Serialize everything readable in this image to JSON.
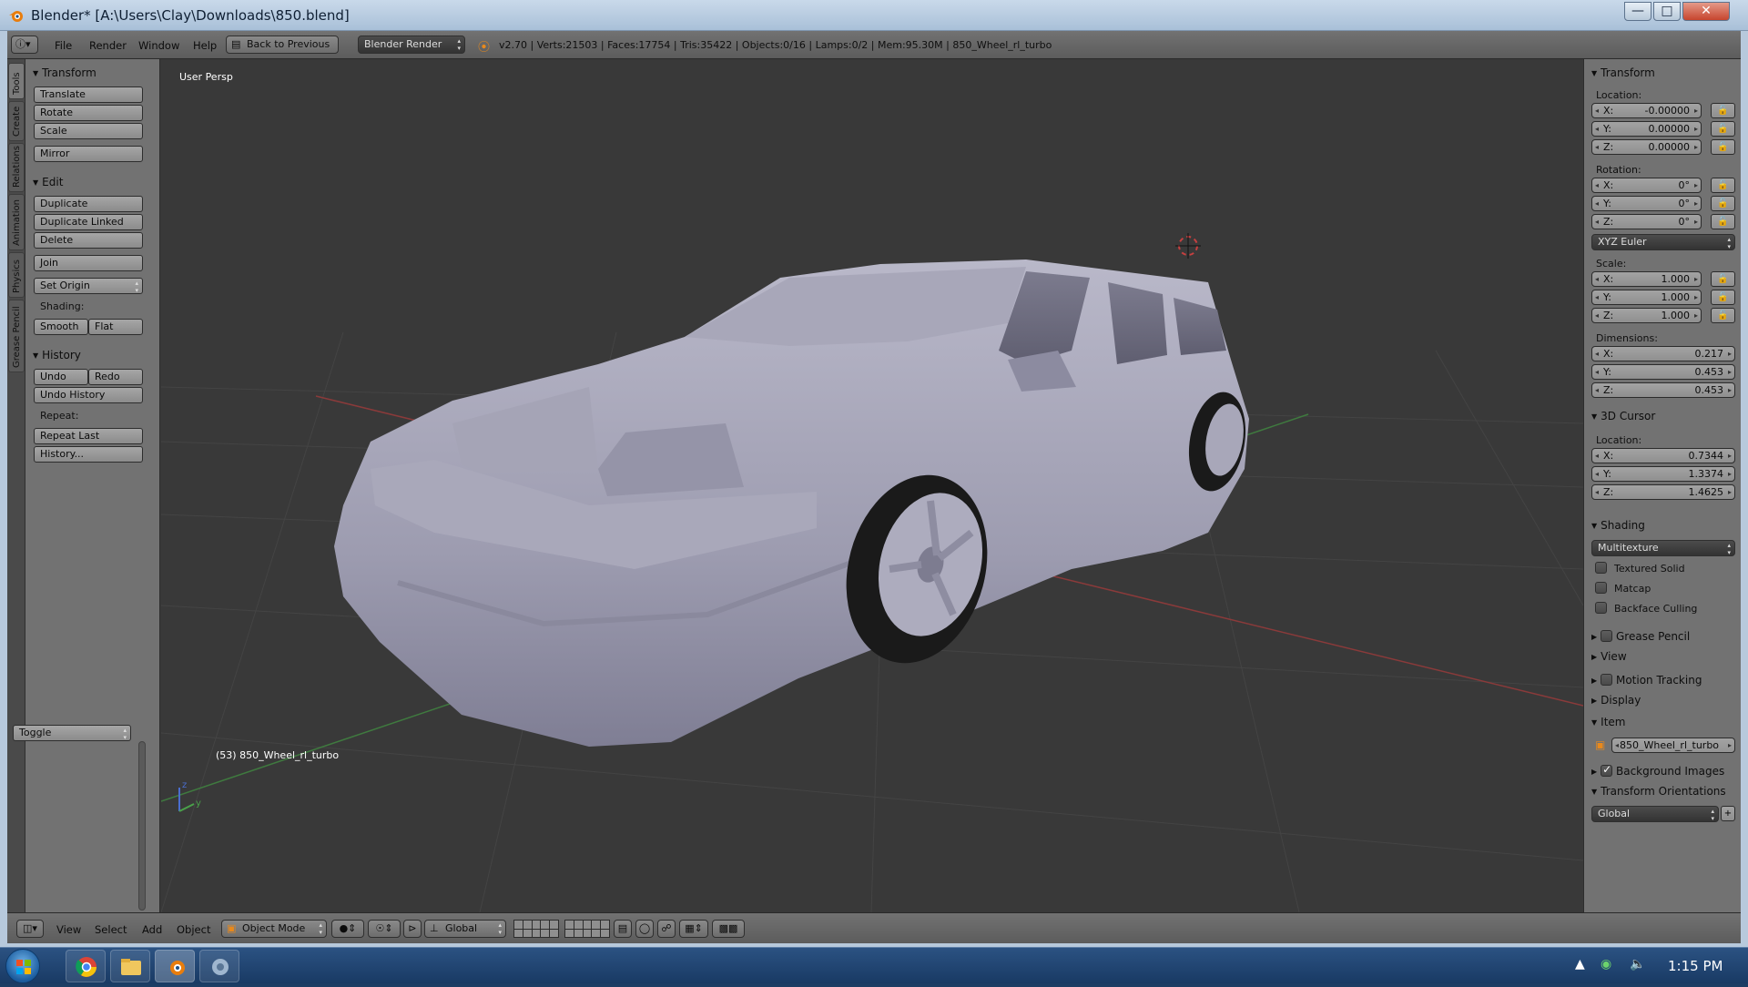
{
  "window": {
    "title": "Blender* [A:\\Users\\Clay\\Downloads\\850.blend]",
    "min": "—",
    "max": "□",
    "close": "✕"
  },
  "header": {
    "menus": [
      "File",
      "Render",
      "Window",
      "Help"
    ],
    "back_button": "Back to Previous",
    "engine": "Blender Render",
    "stats": "v2.70 | Verts:21503 | Faces:17754 | Tris:35422 | Objects:0/16 | Lamps:0/2 | Mem:95.30M | 850_Wheel_rl_turbo"
  },
  "tabs": [
    "Tools",
    "Create",
    "Relations",
    "Animation",
    "Physics",
    "Grease Pencil"
  ],
  "toolshelf": {
    "transform": {
      "title": "Transform",
      "translate": "Translate",
      "rotate": "Rotate",
      "scale": "Scale",
      "mirror": "Mirror"
    },
    "edit": {
      "title": "Edit",
      "duplicate": "Duplicate",
      "duplicate_linked": "Duplicate Linked",
      "delete": "Delete",
      "join": "Join",
      "set_origin": "Set Origin",
      "shading_label": "Shading:",
      "smooth": "Smooth",
      "flat": "Flat"
    },
    "history": {
      "title": "History",
      "undo": "Undo",
      "redo": "Redo",
      "undo_history": "Undo History",
      "repeat_label": "Repeat:",
      "repeat_last": "Repeat Last",
      "history_btn": "History..."
    },
    "toggle": "Toggle"
  },
  "viewport": {
    "label": "User Persp",
    "object_label": "(53) 850_Wheel_rl_turbo",
    "axis_z": "z",
    "axis_y": "y"
  },
  "properties": {
    "transform": {
      "title": "Transform",
      "location_label": "Location:",
      "loc": [
        "-0.00000",
        "0.00000",
        "0.00000"
      ],
      "rotation_label": "Rotation:",
      "rot": [
        "0°",
        "0°",
        "0°"
      ],
      "rot_mode": "XYZ Euler",
      "scale_label": "Scale:",
      "scale": [
        "1.000",
        "1.000",
        "1.000"
      ],
      "dimensions_label": "Dimensions:",
      "dims": [
        "0.217",
        "0.453",
        "0.453"
      ]
    },
    "axes": [
      "X:",
      "Y:",
      "Z:"
    ],
    "cursor": {
      "title": "3D Cursor",
      "location_label": "Location:",
      "loc": [
        "0.7344",
        "1.3374",
        "1.4625"
      ]
    },
    "shading": {
      "title": "Shading",
      "mode": "Multitexture",
      "textured_solid": "Textured Solid",
      "matcap": "Matcap",
      "backface_culling": "Backface Culling"
    },
    "grease_pencil": "Grease Pencil",
    "view": "View",
    "motion_tracking": "Motion Tracking",
    "display": "Display",
    "item": {
      "title": "Item",
      "name": "850_Wheel_rl_turbo"
    },
    "background_images": "Background Images",
    "orientations": {
      "title": "Transform Orientations",
      "value": "Global"
    }
  },
  "bottombar": {
    "menus": [
      "View",
      "Select",
      "Add",
      "Object"
    ],
    "mode": "Object Mode",
    "orientation": "Global"
  },
  "taskbar": {
    "clock": "1:15 PM"
  }
}
